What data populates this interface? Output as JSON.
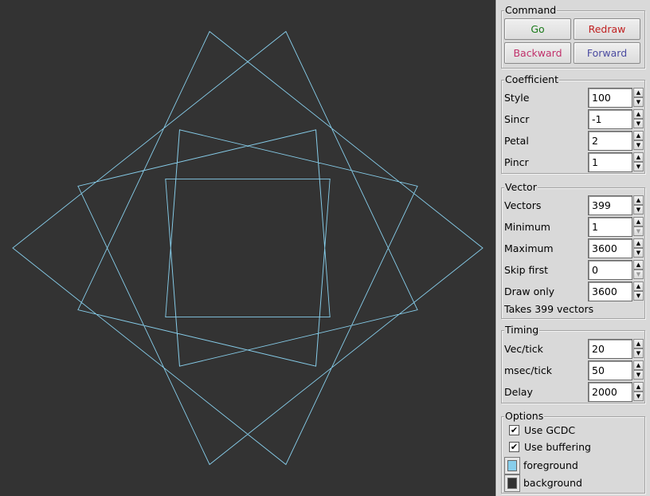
{
  "colors": {
    "canvas_bg": "#333333",
    "curve": "#87ceeb",
    "go": "#1a7a1a",
    "redraw": "#c02020",
    "backward": "#c0306a",
    "forward": "#4a4aa0"
  },
  "command": {
    "title": "Command",
    "go": "Go",
    "redraw": "Redraw",
    "backward": "Backward",
    "forward": "Forward"
  },
  "coefficient": {
    "title": "Coefficient",
    "fields": [
      {
        "label": "Style",
        "value": "100"
      },
      {
        "label": "Sincr",
        "value": "-1"
      },
      {
        "label": "Petal",
        "value": "2"
      },
      {
        "label": "Pincr",
        "value": "1"
      }
    ]
  },
  "vector": {
    "title": "Vector",
    "fields": [
      {
        "label": "Vectors",
        "value": "399"
      },
      {
        "label": "Minimum",
        "value": "1"
      },
      {
        "label": "Maximum",
        "value": "3600"
      },
      {
        "label": "Skip first",
        "value": "0"
      },
      {
        "label": "Draw only",
        "value": "3600"
      }
    ],
    "note": "Takes 399 vectors"
  },
  "timing": {
    "title": "Timing",
    "fields": [
      {
        "label": "Vec/tick",
        "value": "20"
      },
      {
        "label": "msec/tick",
        "value": "50"
      },
      {
        "label": "Delay",
        "value": "2000"
      }
    ]
  },
  "options": {
    "title": "Options",
    "use_gcdc": "Use GCDC",
    "use_buffering": "Use buffering",
    "foreground": "foreground",
    "background": "background",
    "check_glyph": "✔",
    "up_arrow": "▲",
    "down_arrow": "▼"
  }
}
